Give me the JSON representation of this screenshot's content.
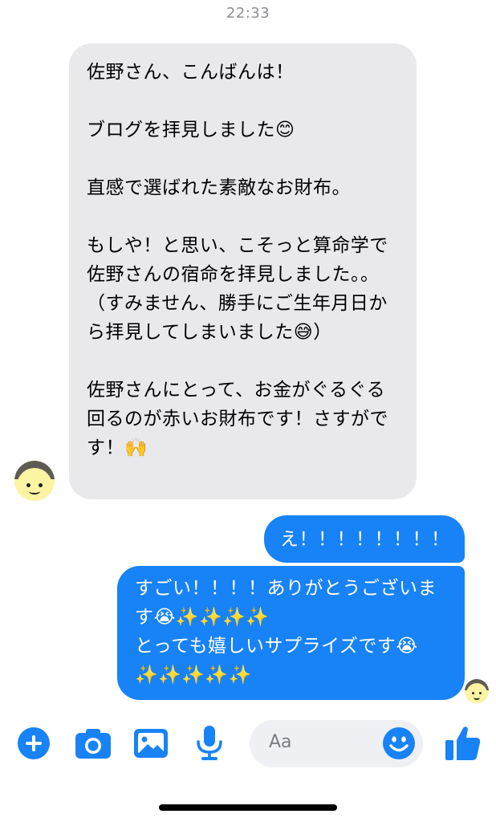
{
  "status": {
    "time": "22:33"
  },
  "incoming": {
    "paragraphs": [
      "佐野さん、こんばんは！",
      "ブログを拝見しました😊",
      "直感で選ばれた素敵なお財布。",
      "もしや！と思い、こそっと算命学で佐野さんの宿命を拝見しました。。（すみません、勝手にご生年月日から拝見してしまいました😅）",
      "佐野さんにとって、お金がぐるぐる回るのが赤いお財布です！さすがです！🙌"
    ]
  },
  "outgoing": [
    {
      "text": "え！！！！！！！！"
    },
    {
      "text": "すごい！！！！ありがとうございます😭✨✨✨✨\nとっても嬉しいサプライズです😭✨✨✨✨✨"
    }
  ],
  "composer": {
    "placeholder": "Aa",
    "icons": [
      "plus-icon",
      "camera-icon",
      "image-icon",
      "microphone-icon",
      "emoji-icon",
      "thumbs-up-icon"
    ]
  },
  "colors": {
    "accent": "#1882f7",
    "incoming_bubble": "#e9e9ec",
    "input_bg": "#eff0f3",
    "timestamp": "#8e8e93"
  }
}
